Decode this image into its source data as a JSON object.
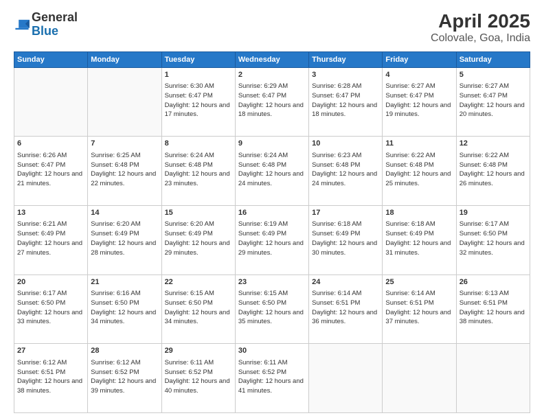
{
  "header": {
    "logo_text_general": "General",
    "logo_text_blue": "Blue",
    "title": "April 2025",
    "subtitle": "Colovale, Goa, India"
  },
  "days_of_week": [
    "Sunday",
    "Monday",
    "Tuesday",
    "Wednesday",
    "Thursday",
    "Friday",
    "Saturday"
  ],
  "weeks": [
    [
      {
        "day": "",
        "info": ""
      },
      {
        "day": "",
        "info": ""
      },
      {
        "day": "1",
        "info": "Sunrise: 6:30 AM\nSunset: 6:47 PM\nDaylight: 12 hours and 17 minutes."
      },
      {
        "day": "2",
        "info": "Sunrise: 6:29 AM\nSunset: 6:47 PM\nDaylight: 12 hours and 18 minutes."
      },
      {
        "day": "3",
        "info": "Sunrise: 6:28 AM\nSunset: 6:47 PM\nDaylight: 12 hours and 18 minutes."
      },
      {
        "day": "4",
        "info": "Sunrise: 6:27 AM\nSunset: 6:47 PM\nDaylight: 12 hours and 19 minutes."
      },
      {
        "day": "5",
        "info": "Sunrise: 6:27 AM\nSunset: 6:47 PM\nDaylight: 12 hours and 20 minutes."
      }
    ],
    [
      {
        "day": "6",
        "info": "Sunrise: 6:26 AM\nSunset: 6:47 PM\nDaylight: 12 hours and 21 minutes."
      },
      {
        "day": "7",
        "info": "Sunrise: 6:25 AM\nSunset: 6:48 PM\nDaylight: 12 hours and 22 minutes."
      },
      {
        "day": "8",
        "info": "Sunrise: 6:24 AM\nSunset: 6:48 PM\nDaylight: 12 hours and 23 minutes."
      },
      {
        "day": "9",
        "info": "Sunrise: 6:24 AM\nSunset: 6:48 PM\nDaylight: 12 hours and 24 minutes."
      },
      {
        "day": "10",
        "info": "Sunrise: 6:23 AM\nSunset: 6:48 PM\nDaylight: 12 hours and 24 minutes."
      },
      {
        "day": "11",
        "info": "Sunrise: 6:22 AM\nSunset: 6:48 PM\nDaylight: 12 hours and 25 minutes."
      },
      {
        "day": "12",
        "info": "Sunrise: 6:22 AM\nSunset: 6:48 PM\nDaylight: 12 hours and 26 minutes."
      }
    ],
    [
      {
        "day": "13",
        "info": "Sunrise: 6:21 AM\nSunset: 6:49 PM\nDaylight: 12 hours and 27 minutes."
      },
      {
        "day": "14",
        "info": "Sunrise: 6:20 AM\nSunset: 6:49 PM\nDaylight: 12 hours and 28 minutes."
      },
      {
        "day": "15",
        "info": "Sunrise: 6:20 AM\nSunset: 6:49 PM\nDaylight: 12 hours and 29 minutes."
      },
      {
        "day": "16",
        "info": "Sunrise: 6:19 AM\nSunset: 6:49 PM\nDaylight: 12 hours and 29 minutes."
      },
      {
        "day": "17",
        "info": "Sunrise: 6:18 AM\nSunset: 6:49 PM\nDaylight: 12 hours and 30 minutes."
      },
      {
        "day": "18",
        "info": "Sunrise: 6:18 AM\nSunset: 6:49 PM\nDaylight: 12 hours and 31 minutes."
      },
      {
        "day": "19",
        "info": "Sunrise: 6:17 AM\nSunset: 6:50 PM\nDaylight: 12 hours and 32 minutes."
      }
    ],
    [
      {
        "day": "20",
        "info": "Sunrise: 6:17 AM\nSunset: 6:50 PM\nDaylight: 12 hours and 33 minutes."
      },
      {
        "day": "21",
        "info": "Sunrise: 6:16 AM\nSunset: 6:50 PM\nDaylight: 12 hours and 34 minutes."
      },
      {
        "day": "22",
        "info": "Sunrise: 6:15 AM\nSunset: 6:50 PM\nDaylight: 12 hours and 34 minutes."
      },
      {
        "day": "23",
        "info": "Sunrise: 6:15 AM\nSunset: 6:50 PM\nDaylight: 12 hours and 35 minutes."
      },
      {
        "day": "24",
        "info": "Sunrise: 6:14 AM\nSunset: 6:51 PM\nDaylight: 12 hours and 36 minutes."
      },
      {
        "day": "25",
        "info": "Sunrise: 6:14 AM\nSunset: 6:51 PM\nDaylight: 12 hours and 37 minutes."
      },
      {
        "day": "26",
        "info": "Sunrise: 6:13 AM\nSunset: 6:51 PM\nDaylight: 12 hours and 38 minutes."
      }
    ],
    [
      {
        "day": "27",
        "info": "Sunrise: 6:12 AM\nSunset: 6:51 PM\nDaylight: 12 hours and 38 minutes."
      },
      {
        "day": "28",
        "info": "Sunrise: 6:12 AM\nSunset: 6:52 PM\nDaylight: 12 hours and 39 minutes."
      },
      {
        "day": "29",
        "info": "Sunrise: 6:11 AM\nSunset: 6:52 PM\nDaylight: 12 hours and 40 minutes."
      },
      {
        "day": "30",
        "info": "Sunrise: 6:11 AM\nSunset: 6:52 PM\nDaylight: 12 hours and 41 minutes."
      },
      {
        "day": "",
        "info": ""
      },
      {
        "day": "",
        "info": ""
      },
      {
        "day": "",
        "info": ""
      }
    ]
  ]
}
